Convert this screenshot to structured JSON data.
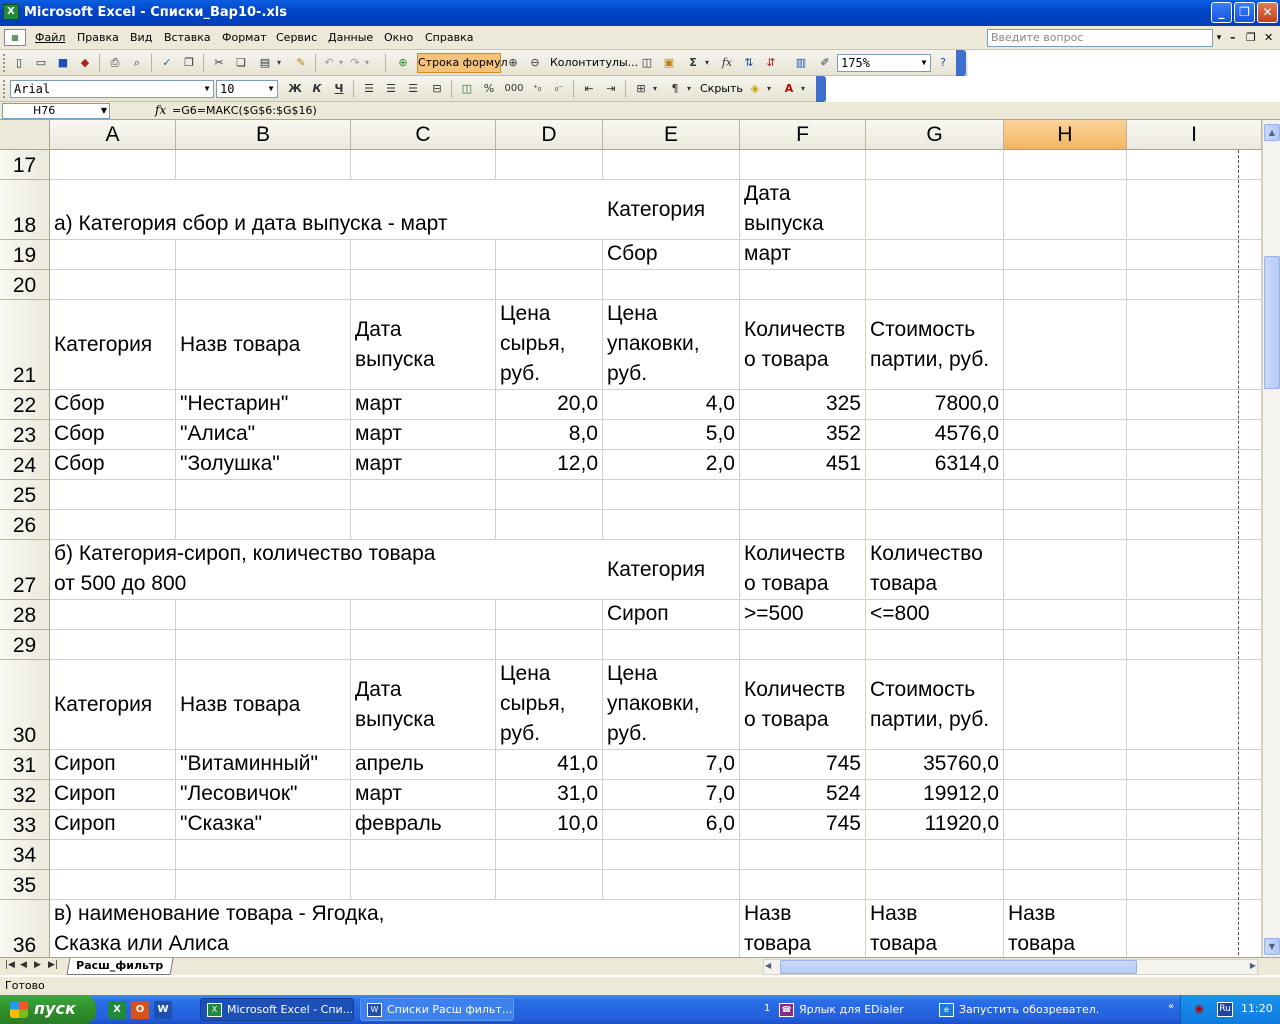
{
  "window": {
    "title": "Microsoft Excel - Списки_Вар10-.xls",
    "app_icon": "excel-icon",
    "minimize": "_",
    "restore": "❐",
    "close": "✕"
  },
  "menu": {
    "items": [
      "Файл",
      "Правка",
      "Вид",
      "Вставка",
      "Формат",
      "Сервис",
      "Данные",
      "Окно",
      "Справка"
    ],
    "ask_placeholder": "Введите вопрос",
    "ask_dropdown": "▾",
    "doc_min": "–",
    "doc_restore": "❐",
    "doc_close": "✕"
  },
  "toolbar1": {
    "formula_bar_button": "Строка формул",
    "headers_footers": "Колонтитулы...",
    "zoom": "175%",
    "sigma": "Σ",
    "fx": "fx"
  },
  "toolbar2": {
    "font": "Arial",
    "size": "10",
    "bold": "Ж",
    "italic": "К",
    "underline": "Ч",
    "percent": "%",
    "thousands": "000",
    "hide_label": "Скрыть"
  },
  "formula_bar": {
    "name_box": "H76",
    "fx_label": "fx",
    "formula": "=G6=МАКС($G$6:$G$16)"
  },
  "columns": [
    "A",
    "B",
    "C",
    "D",
    "E",
    "F",
    "G",
    "H",
    "I"
  ],
  "selected_column": "H",
  "rows": [
    {
      "n": "17",
      "cells": []
    },
    {
      "n": "18",
      "cells": [
        {
          "col": "A",
          "span": 4,
          "text": " а) Категория сбор и дата выпуска - март"
        },
        {
          "col": "E",
          "text": "Категория",
          "valign": "mid"
        },
        {
          "col": "F",
          "text": "Дата\nвыпуска"
        }
      ]
    },
    {
      "n": "19",
      "cells": [
        {
          "col": "E",
          "text": "Сбор"
        },
        {
          "col": "F",
          "text": "март"
        }
      ]
    },
    {
      "n": "20",
      "cells": []
    },
    {
      "n": "21",
      "cells": [
        {
          "col": "A",
          "text": "Категория",
          "valign": "mid"
        },
        {
          "col": "B",
          "text": "Назв товара",
          "valign": "mid"
        },
        {
          "col": "C",
          "text": "Дата\nвыпуска",
          "valign": "mid"
        },
        {
          "col": "D",
          "text": "Цена\nсырья,\nруб."
        },
        {
          "col": "E",
          "text": "Цена\nупаковки,\nруб."
        },
        {
          "col": "F",
          "text": "Количеств\nо товара",
          "valign": "mid"
        },
        {
          "col": "G",
          "text": " Стоимость\nпартии, руб.",
          "valign": "mid"
        }
      ]
    },
    {
      "n": "22",
      "cells": [
        {
          "col": "A",
          "text": "Сбор"
        },
        {
          "col": "B",
          "text": "\"Нестарин\""
        },
        {
          "col": "C",
          "text": "март"
        },
        {
          "col": "D",
          "text": "20,0",
          "align": "r"
        },
        {
          "col": "E",
          "text": "4,0",
          "align": "r"
        },
        {
          "col": "F",
          "text": "325",
          "align": "r"
        },
        {
          "col": "G",
          "text": "7800,0",
          "align": "r"
        }
      ]
    },
    {
      "n": "23",
      "cells": [
        {
          "col": "A",
          "text": "Сбор"
        },
        {
          "col": "B",
          "text": "\"Алиса\""
        },
        {
          "col": "C",
          "text": "март"
        },
        {
          "col": "D",
          "text": "8,0",
          "align": "r"
        },
        {
          "col": "E",
          "text": "5,0",
          "align": "r"
        },
        {
          "col": "F",
          "text": "352",
          "align": "r"
        },
        {
          "col": "G",
          "text": "4576,0",
          "align": "r"
        }
      ]
    },
    {
      "n": "24",
      "cells": [
        {
          "col": "A",
          "text": "Сбор"
        },
        {
          "col": "B",
          "text": "\"Золушка\""
        },
        {
          "col": "C",
          "text": "март"
        },
        {
          "col": "D",
          "text": "12,0",
          "align": "r"
        },
        {
          "col": "E",
          "text": "2,0",
          "align": "r"
        },
        {
          "col": "F",
          "text": "451",
          "align": "r"
        },
        {
          "col": "G",
          "text": "6314,0",
          "align": "r"
        }
      ]
    },
    {
      "n": "25",
      "cells": []
    },
    {
      "n": "26",
      "cells": []
    },
    {
      "n": "27",
      "cells": [
        {
          "col": "A",
          "span": 4,
          "text": "б) Категория-сироп, количество товара\nот 500 до 800"
        },
        {
          "col": "E",
          "text": "Категория",
          "valign": "mid"
        },
        {
          "col": "F",
          "text": "Количеств\nо товара"
        },
        {
          "col": "G",
          "text": "Количество\nтовара"
        }
      ]
    },
    {
      "n": "28",
      "cells": [
        {
          "col": "E",
          "text": "Сироп"
        },
        {
          "col": "F",
          "text": ">=500"
        },
        {
          "col": "G",
          "text": "<=800"
        }
      ]
    },
    {
      "n": "29",
      "cells": []
    },
    {
      "n": "30",
      "cells": [
        {
          "col": "A",
          "text": "Категория",
          "valign": "mid"
        },
        {
          "col": "B",
          "text": "Назв товара",
          "valign": "mid"
        },
        {
          "col": "C",
          "text": "Дата\nвыпуска",
          "valign": "mid"
        },
        {
          "col": "D",
          "text": "Цена\nсырья,\nруб."
        },
        {
          "col": "E",
          "text": "Цена\nупаковки,\nруб."
        },
        {
          "col": "F",
          "text": "Количеств\nо товара",
          "valign": "mid"
        },
        {
          "col": "G",
          "text": " Стоимость\nпартии, руб.",
          "valign": "mid"
        }
      ]
    },
    {
      "n": "31",
      "cells": [
        {
          "col": "A",
          "text": "Сироп"
        },
        {
          "col": "B",
          "text": "\"Витаминный\""
        },
        {
          "col": "C",
          "text": "апрель"
        },
        {
          "col": "D",
          "text": "41,0",
          "align": "r"
        },
        {
          "col": "E",
          "text": "7,0",
          "align": "r"
        },
        {
          "col": "F",
          "text": "745",
          "align": "r"
        },
        {
          "col": "G",
          "text": "35760,0",
          "align": "r"
        }
      ]
    },
    {
      "n": "32",
      "cells": [
        {
          "col": "A",
          "text": "Сироп"
        },
        {
          "col": "B",
          "text": "\"Лесовичок\""
        },
        {
          "col": "C",
          "text": "март"
        },
        {
          "col": "D",
          "text": "31,0",
          "align": "r"
        },
        {
          "col": "E",
          "text": "7,0",
          "align": "r"
        },
        {
          "col": "F",
          "text": "524",
          "align": "r"
        },
        {
          "col": "G",
          "text": "19912,0",
          "align": "r"
        }
      ]
    },
    {
      "n": "33",
      "cells": [
        {
          "col": "A",
          "text": "Сироп"
        },
        {
          "col": "B",
          "text": "\"Сказка\""
        },
        {
          "col": "C",
          "text": "февраль"
        },
        {
          "col": "D",
          "text": "10,0",
          "align": "r"
        },
        {
          "col": "E",
          "text": "6,0",
          "align": "r"
        },
        {
          "col": "F",
          "text": "745",
          "align": "r"
        },
        {
          "col": "G",
          "text": "11920,0",
          "align": "r"
        }
      ]
    },
    {
      "n": "34",
      "cells": []
    },
    {
      "n": "35",
      "cells": []
    },
    {
      "n": "36",
      "cells": [
        {
          "col": "A",
          "span": 4,
          "text": "в) наименование товара - Ягодка,\nСказка или Алиса"
        },
        {
          "col": "F",
          "text": "Назв\nтовара"
        },
        {
          "col": "G",
          "text": "Назв\nтовара"
        },
        {
          "col": "H",
          "text": "Назв\nтовара"
        }
      ]
    }
  ],
  "sheet_tab": "Расш_фильтр",
  "status": "Готово",
  "taskbar": {
    "start": "пуск",
    "quick_launch": [
      "X",
      "O",
      "W"
    ],
    "tasks": [
      "Microsoft Excel - Спи...",
      "Списки Расш фильт..."
    ],
    "group_count": "1",
    "tray_items": [
      "Ярлык для EDialer",
      "Запустить обозревател..."
    ],
    "lang": "Ru",
    "clock": "11:20"
  },
  "colors": {
    "selected_header": "#f5c27a",
    "title_blue": "#0345c8",
    "taskbar_blue": "#245fdc",
    "start_green": "#3a9f35"
  }
}
